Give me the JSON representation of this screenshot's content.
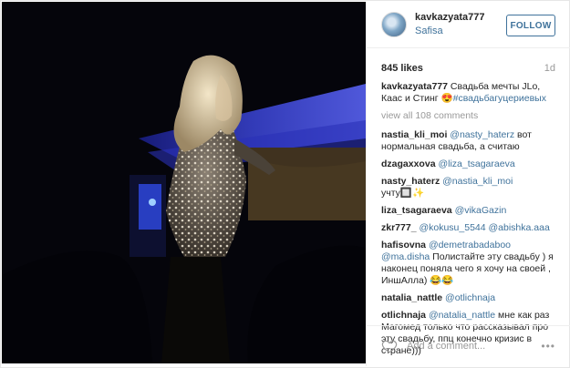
{
  "header": {
    "username": "kavkazyata777",
    "location": "Safisa",
    "follow_label": "FOLLOW"
  },
  "post": {
    "likes": "845 likes",
    "age": "1d",
    "caption": {
      "author": "kavkazyata777",
      "text": " Свадьба мечты JLo, Каас и Стинг 😍",
      "hashtag": "#свадьбагуцериевых"
    },
    "view_all": "view all 108 comments"
  },
  "comments": [
    {
      "author": "nastia_kli_moi",
      "mention": "@nasty_haterz",
      "text": " вот нормальная свадьба, а считаю"
    },
    {
      "author": "dzagaxxova",
      "mention": "@liza_tsagaraeva",
      "text": ""
    },
    {
      "author": "nasty_haterz",
      "mention": "@nastia_kli_moi",
      "text": " учту🔲✨"
    },
    {
      "author": "liza_tsagaraeva",
      "mention": "@vikaGazin",
      "text": ""
    },
    {
      "author": "zkr777_",
      "mention": "@kokusu_5544 @abishka.aaa",
      "text": ""
    },
    {
      "author": "hafisovna",
      "mention": "@demetrabadaboo @ma.disha",
      "text": " Полистайте эту свадьбу ) я наконец поняла чего я хочу на своей , ИншАлла) 😂😂"
    },
    {
      "author": "natalia_nattle",
      "mention": "@otlichnaja",
      "text": ""
    },
    {
      "author": "otlichnaja",
      "mention": "@natalia_nattle",
      "text": " мне как раз Магомед только что рассказывал про эту свадьбу, ппц конечно кризис в стране)))"
    }
  ],
  "footer": {
    "placeholder": "Add a comment...",
    "more": "•••"
  }
}
